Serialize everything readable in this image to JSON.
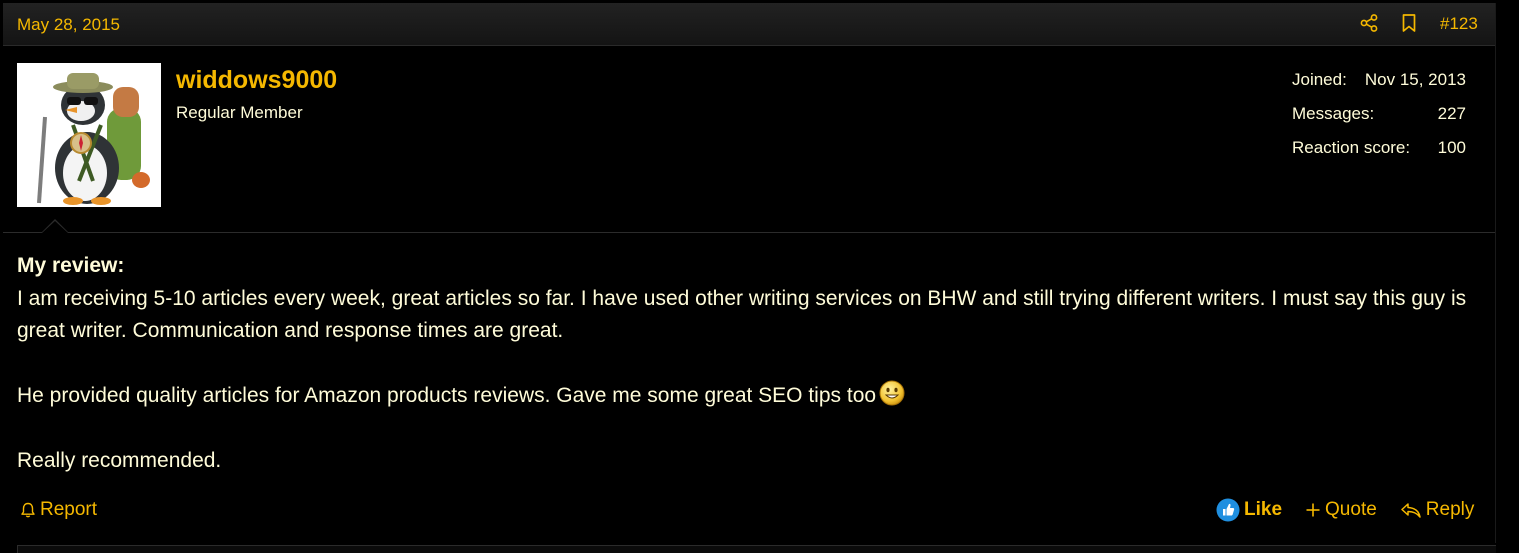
{
  "post": {
    "date": "May 28, 2015",
    "number": "#123",
    "accent_color": "#f5b800",
    "text_color": "#fffcd9"
  },
  "user": {
    "name": "widdows9000",
    "title": "Regular Member",
    "avatar_icon": "penguin-hiker-avatar",
    "stats": [
      {
        "label": "Joined:",
        "value": "Nov 15, 2013"
      },
      {
        "label": "Messages:",
        "value": "227"
      },
      {
        "label": "Reaction score:",
        "value": "100"
      }
    ]
  },
  "message": {
    "heading": "My review:",
    "paragraph1": "I am receiving 5-10 articles every week, great articles so far. I have used other writing services on BHW and still trying different writers. I must say this guy is great writer. Communication and response times are great.",
    "paragraph2": "He provided quality articles for Amazon products reviews. Gave me some great SEO tips too",
    "smiley_icon": "grin-smiley-icon",
    "paragraph3": "Really recommended."
  },
  "actions": {
    "report": "Report",
    "like": "Like",
    "quote": "Quote",
    "reply": "Reply"
  }
}
